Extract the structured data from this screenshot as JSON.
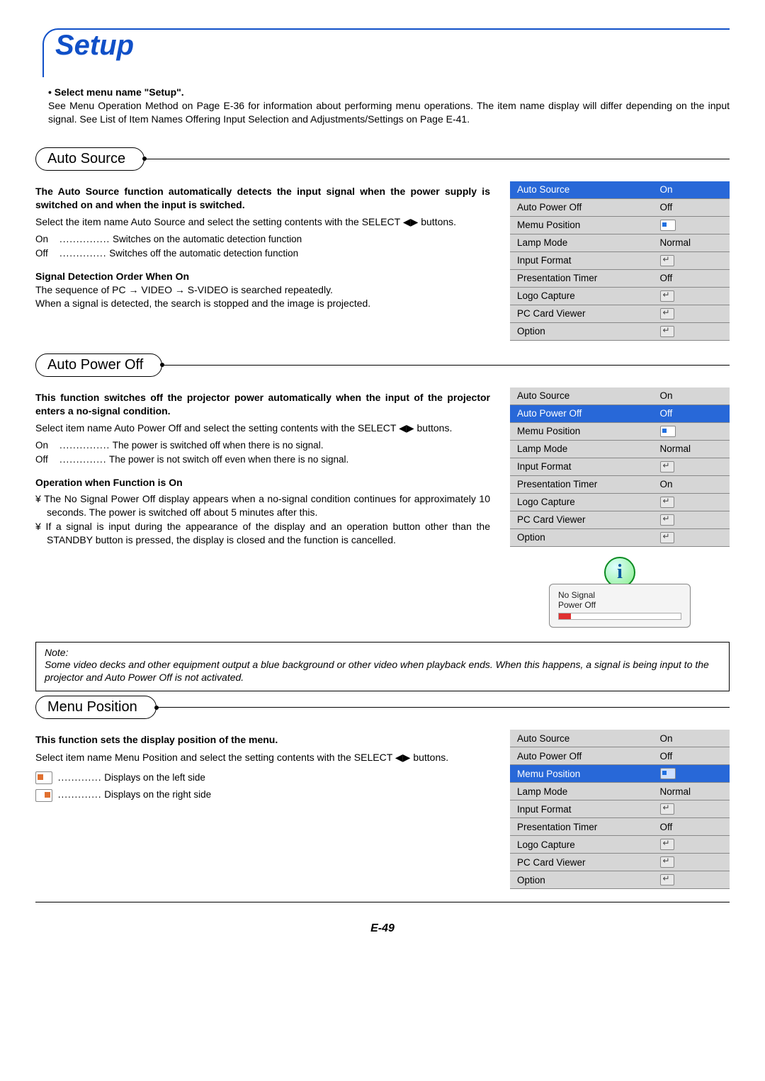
{
  "page": {
    "title": "Setup",
    "footer": "E-49"
  },
  "intro": {
    "lead": "• Select menu name \"Setup\".",
    "body": "See Menu Operation Method on Page E-36 for information about performing menu operations. The item name display will differ depending on the input signal. See List of Item Names Offering Input Selection and Adjustments/Settings on Page E-41."
  },
  "sections": {
    "auto_source": {
      "heading": "Auto Source",
      "p1": "The Auto Source function automatically detects the input signal when the power supply is switched on and when the input is switched.",
      "p2": "Select the item name Auto Source and select the setting contents with the SELECT ◀▶ buttons.",
      "on_label": "On",
      "on_desc": "Switches on the automatic detection function",
      "off_label": "Off",
      "off_desc": "Switches off the automatic detection function",
      "sub_h": "Signal Detection Order When On",
      "sub_p1": "The sequence of PC → VIDEO → S-VIDEO is searched repeatedly.",
      "sub_p2": "When a signal is detected, the search is stopped and the image is projected."
    },
    "auto_power_off": {
      "heading": "Auto Power Off",
      "p1": "This function switches off the projector power automatically when the input of the projector enters a no-signal condition.",
      "p2": "Select item name Auto Power Off and select the setting contents with the SELECT ◀▶ buttons.",
      "on_label": "On",
      "on_desc": "The power is switched off when there is no signal.",
      "off_label": "Off",
      "off_desc": "The power is not switch off even when there is no signal.",
      "sub_h": "Operation when Function is On",
      "li1": "The No Signal Power Off display appears when a no-signal condition continues for approximately 10 seconds. The power is switched off about 5 minutes after this.",
      "li2": "If a signal is input during the appearance of the display and an operation button other than the STANDBY button is pressed, the display is closed and the function is cancelled.",
      "info_line1": "No Signal",
      "info_line2": "Power Off"
    },
    "menu_position": {
      "heading": "Menu Position",
      "p1": "This function sets the display position of the menu.",
      "p2": "Select item name Menu Position and select the setting contents with the SELECT ◀▶ buttons.",
      "left_desc": "Displays on the left side",
      "right_desc": "Displays on the right side"
    }
  },
  "note": {
    "heading": "Note:",
    "body": "Some video decks and other equipment output a blue background or other video when playback ends. When this happens, a signal is being input to the projector and Auto Power Off is not activated."
  },
  "osd": {
    "rows": [
      {
        "label": "Auto Source",
        "value": "On",
        "type": "text"
      },
      {
        "label": "Auto Power Off",
        "value": "Off",
        "type": "text"
      },
      {
        "label": "Memu Position",
        "value": "",
        "type": "pos"
      },
      {
        "label": "Lamp Mode",
        "value": "Normal",
        "type": "text"
      },
      {
        "label": "Input Format",
        "value": "",
        "type": "enter"
      },
      {
        "label": "Presentation Timer",
        "value": "Off",
        "type": "text"
      },
      {
        "label": "Logo Capture",
        "value": "",
        "type": "enter"
      },
      {
        "label": "PC Card Viewer",
        "value": "",
        "type": "enter"
      },
      {
        "label": "Option",
        "value": "",
        "type": "enter"
      }
    ],
    "variants": {
      "a_selected_index": 0,
      "b_selected_index": 1,
      "b_presentation_value": "On",
      "c_selected_index": 2
    }
  }
}
